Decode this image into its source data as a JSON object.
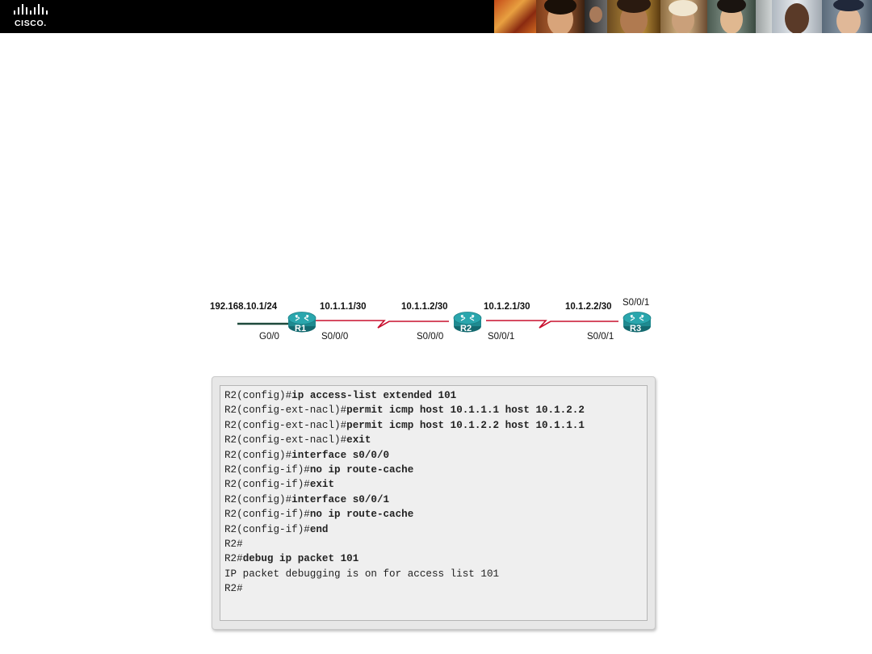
{
  "header": {
    "logo_text": "CISCO."
  },
  "topology": {
    "routers": [
      {
        "name": "R1"
      },
      {
        "name": "R2"
      },
      {
        "name": "R3"
      }
    ],
    "labels": {
      "lan": "192.168.10.1/24",
      "g00": "G0/0",
      "r1_s000": "S0/0/0",
      "r1_ip": "10.1.1.1/30",
      "r2_s000_ip": "10.1.1.2/30",
      "r2_s000": "S0/0/0",
      "r2_s001_ip": "10.1.2.1/30",
      "r2_s001": "S0/0/1",
      "r3_ip": "10.1.2.2/30",
      "r3_s001_bottom": "S0/0/1",
      "r3_s001_top": "S0/0/1"
    }
  },
  "terminal": {
    "lines": [
      {
        "prompt": "R2(config)#",
        "cmd": "ip access-list extended 101"
      },
      {
        "prompt": "R2(config-ext-nacl)#",
        "cmd": "permit icmp host 10.1.1.1 host 10.1.2.2"
      },
      {
        "prompt": "R2(config-ext-nacl)#",
        "cmd": "permit icmp host 10.1.2.2 host 10.1.1.1"
      },
      {
        "prompt": "R2(config-ext-nacl)#",
        "cmd": "exit"
      },
      {
        "prompt": "R2(config)#",
        "cmd": "interface s0/0/0"
      },
      {
        "prompt": "R2(config-if)#",
        "cmd": "no ip route-cache"
      },
      {
        "prompt": "R2(config-if)#",
        "cmd": "exit"
      },
      {
        "prompt": "R2(config)#",
        "cmd": "interface s0/0/1"
      },
      {
        "prompt": "R2(config-if)#",
        "cmd": "no ip route-cache"
      },
      {
        "prompt": "R2(config-if)#",
        "cmd": "end"
      },
      {
        "prompt": "R2#",
        "cmd": ""
      },
      {
        "prompt": "R2#",
        "cmd": "debug ip packet 101"
      },
      {
        "prompt": "IP packet debugging is on for access list 101",
        "cmd": ""
      },
      {
        "prompt": "R2#",
        "cmd": ""
      }
    ]
  },
  "colors": {
    "router_body": "#1f8a90",
    "router_top": "#2aa6ad",
    "serial_link": "#c8102e",
    "ethernet_link": "#1e4a3c"
  }
}
